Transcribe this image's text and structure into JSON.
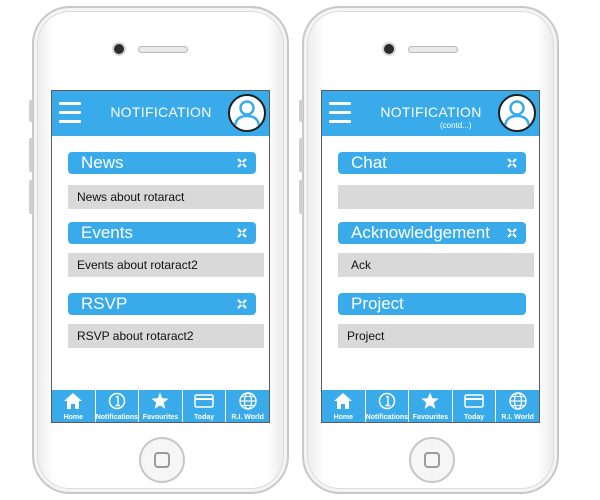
{
  "colors": {
    "accent": "#3aabea",
    "content_bg": "#d9d9d9"
  },
  "left_screen": {
    "header": {
      "title": "NOTIFICATION"
    },
    "sections": [
      {
        "title": "News",
        "content": "News about rotaract"
      },
      {
        "title": "Events",
        "content": "Events about rotaract2"
      },
      {
        "title": "RSVP",
        "content": "RSVP about rotaract2"
      }
    ],
    "tabs": [
      {
        "label": "Home",
        "icon": "home-icon"
      },
      {
        "label": "Notifications",
        "icon": "notification-icon"
      },
      {
        "label": "Favourites",
        "icon": "star-icon"
      },
      {
        "label": "Today",
        "icon": "card-icon"
      },
      {
        "label": "R.I. World",
        "icon": "globe-icon"
      }
    ]
  },
  "right_screen": {
    "header": {
      "title": "NOTIFICATION",
      "subtitle": "(contd...)"
    },
    "sections": [
      {
        "title": "Chat",
        "content": ""
      },
      {
        "title": "Acknowledgement",
        "content": "Ack"
      },
      {
        "title": "Project",
        "content": "Project"
      }
    ],
    "tabs": [
      {
        "label": "Home",
        "icon": "home-icon"
      },
      {
        "label": "Notifications",
        "icon": "notification-icon"
      },
      {
        "label": "Favourites",
        "icon": "star-icon"
      },
      {
        "label": "Today",
        "icon": "card-icon"
      },
      {
        "label": "R.I. World",
        "icon": "globe-icon"
      }
    ]
  }
}
